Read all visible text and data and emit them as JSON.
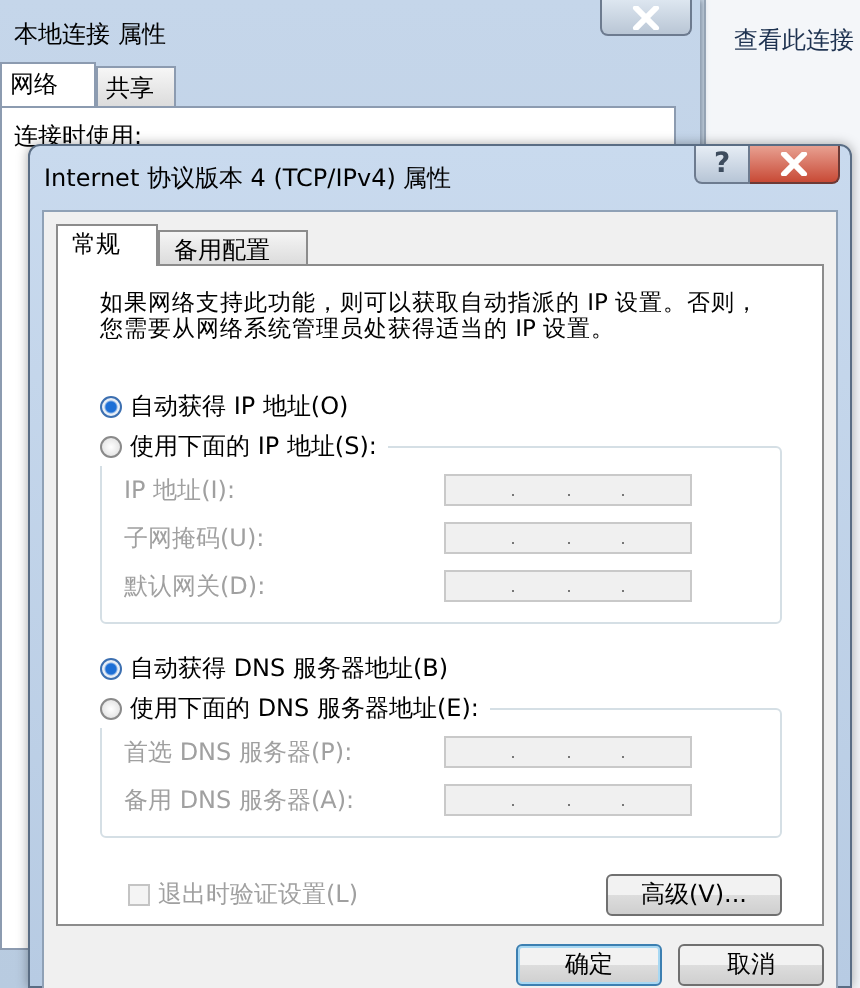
{
  "back_window": {
    "title": "本地连接 属性",
    "tabs": [
      {
        "label": "网络",
        "selected": true
      },
      {
        "label": "共享",
        "selected": false
      }
    ],
    "connect_label": "连接时使用:"
  },
  "side_window": {
    "text": "查看此连接"
  },
  "dialog": {
    "title": "Internet 协议版本 4 (TCP/IPv4) 属性",
    "help_button": "?",
    "tabs": [
      {
        "label": "常规",
        "selected": true
      },
      {
        "label": "备用配置",
        "selected": false
      }
    ],
    "description": "如果网络支持此功能，则可以获取自动指派的 IP 设置。否则，您需要从网络系统管理员处获得适当的 IP 设置。",
    "groups": [
      {
        "auto_option": {
          "label": "自动获得 IP 地址(O)",
          "selected": true
        },
        "manual_option": {
          "label": "使用下面的 IP 地址(S):",
          "selected": false
        },
        "fields": [
          {
            "label": "IP 地址(I):",
            "disabled": true
          },
          {
            "label": "子网掩码(U):",
            "disabled": true
          },
          {
            "label": "默认网关(D):",
            "disabled": true
          }
        ]
      },
      {
        "auto_option": {
          "label": "自动获得 DNS 服务器地址(B)",
          "selected": true
        },
        "manual_option": {
          "label": "使用下面的 DNS 服务器地址(E):",
          "selected": false
        },
        "fields": [
          {
            "label": "首选 DNS 服务器(P):",
            "disabled": true
          },
          {
            "label": "备用 DNS 服务器(A):",
            "disabled": true
          }
        ]
      }
    ],
    "validate_checkbox": {
      "label": "退出时验证设置(L)",
      "checked": false,
      "disabled": true
    },
    "advanced_button": "高级(V)...",
    "buttons": [
      "确定",
      "取消"
    ]
  }
}
